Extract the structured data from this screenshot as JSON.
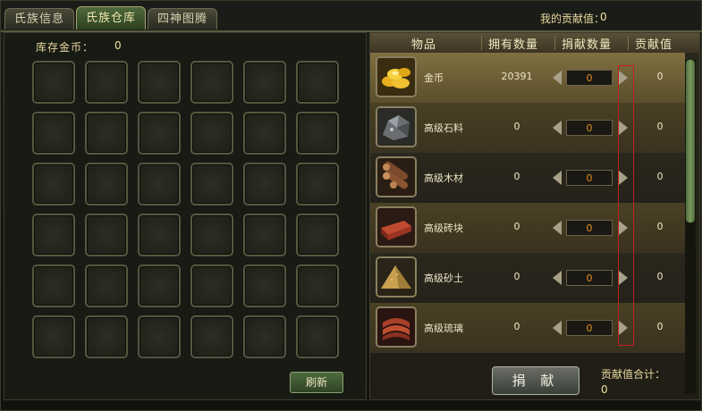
{
  "tabs": [
    {
      "label": "氏族信息",
      "active": false
    },
    {
      "label": "氏族仓库",
      "active": true
    },
    {
      "label": "四神图腾",
      "active": false
    }
  ],
  "header": {
    "my_contribution_label": "我的贡献值：",
    "my_contribution_value": "0"
  },
  "warehouse": {
    "gold_label": "库存金币：",
    "gold_value": "0",
    "rows": 6,
    "cols": 6,
    "refresh_label": "刷新"
  },
  "donation": {
    "columns": [
      "物品",
      "拥有数量",
      "捐献数量",
      "贡献值"
    ],
    "items": [
      {
        "name": "金币",
        "icon": "gold-coins-icon",
        "owned": "20391",
        "donate": "0",
        "value": "0"
      },
      {
        "name": "高级石料",
        "icon": "stone-icon",
        "owned": "0",
        "donate": "0",
        "value": "0"
      },
      {
        "name": "高级木材",
        "icon": "wood-logs-icon",
        "owned": "0",
        "donate": "0",
        "value": "0"
      },
      {
        "name": "高级砖块",
        "icon": "brick-icon",
        "owned": "0",
        "donate": "0",
        "value": "0"
      },
      {
        "name": "高级砂土",
        "icon": "sand-pile-icon",
        "owned": "0",
        "donate": "0",
        "value": "0"
      },
      {
        "name": "高级琉璃",
        "icon": "glazed-tile-icon",
        "owned": "0",
        "donate": "0",
        "value": "0"
      }
    ],
    "donate_button": "捐 献",
    "total_label": "贡献值合计：",
    "total_value": "0"
  },
  "colors": {
    "accent_green": "#4e6a3e",
    "qty_text": "#e09020",
    "highlight_box": "#c02020"
  }
}
